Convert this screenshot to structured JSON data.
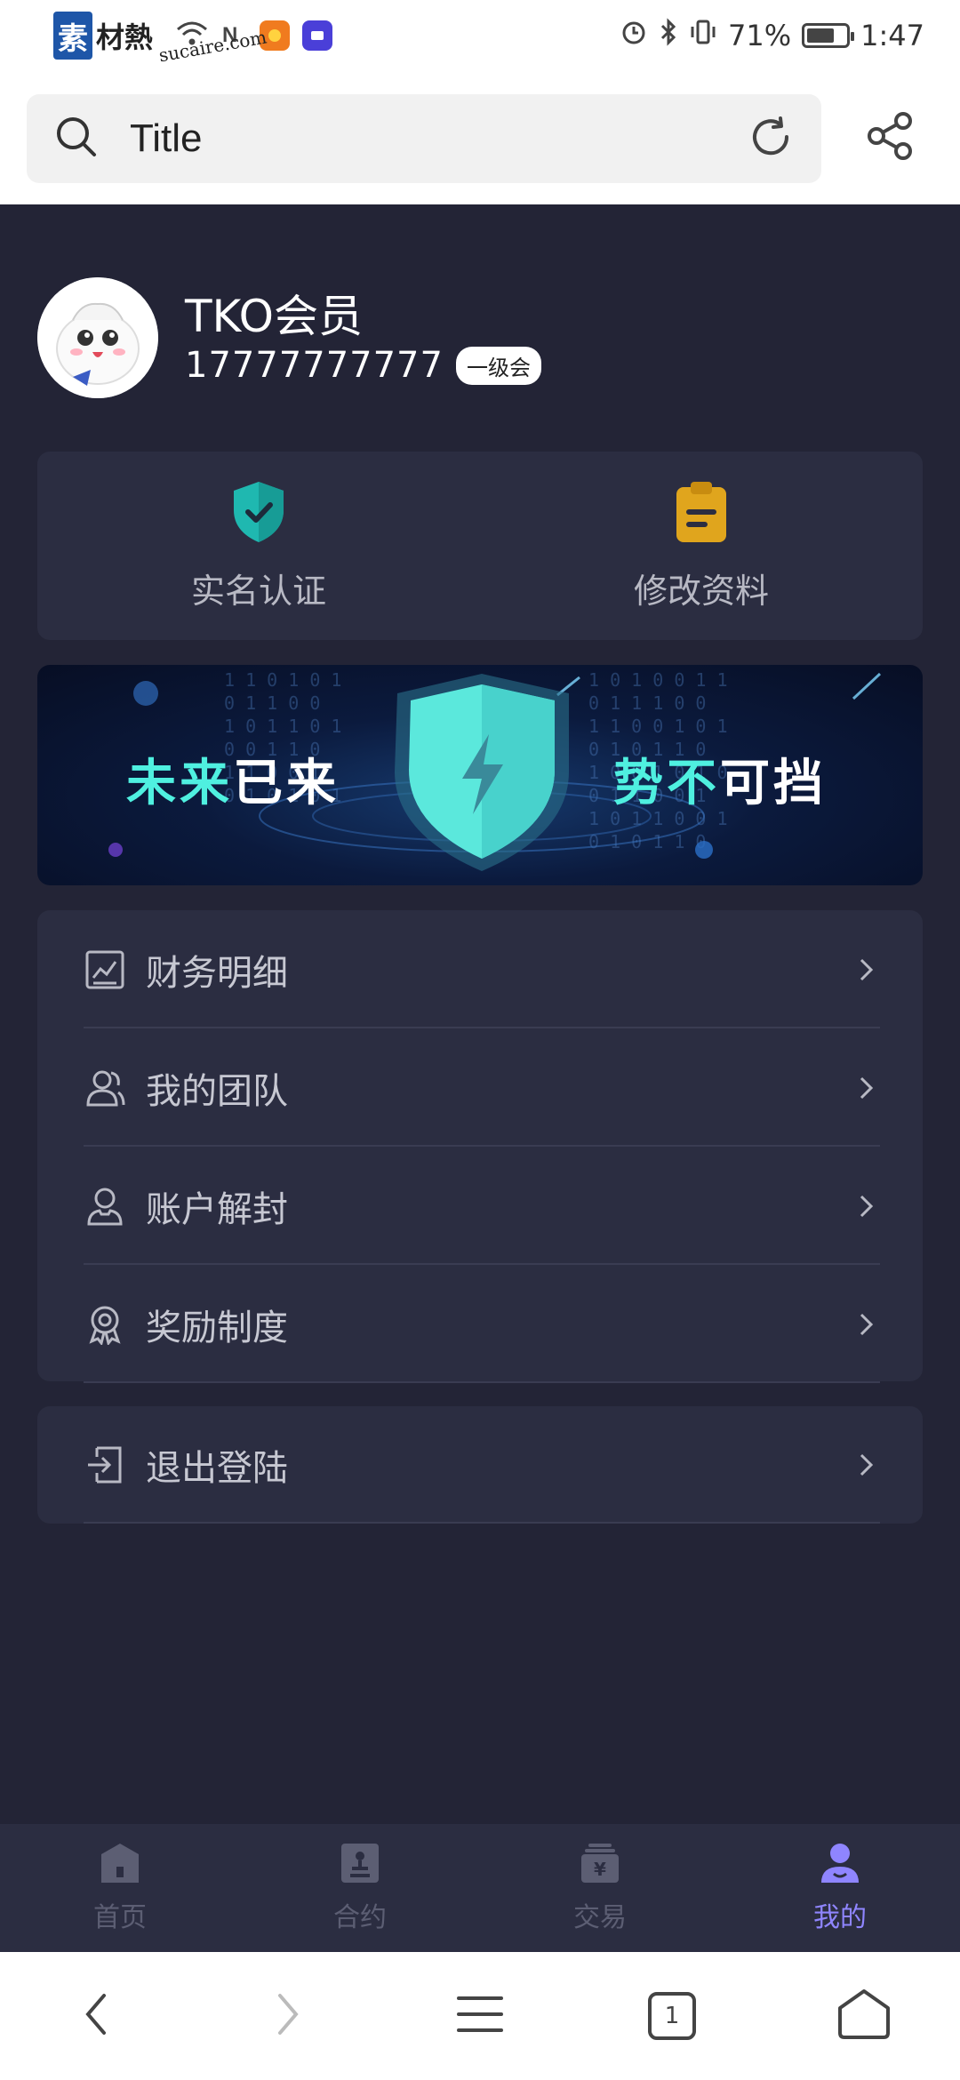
{
  "status_bar": {
    "watermark_main": "素",
    "watermark_text": "材熱",
    "watermark_sub": "sucaire.com",
    "battery_percent": "71%",
    "battery_level": 0.71,
    "time": "1:47"
  },
  "search": {
    "title": "Title",
    "search_icon": "search-icon",
    "refresh_icon": "refresh-icon",
    "share_icon": "share-icon"
  },
  "profile": {
    "name": "TKO会员",
    "phone": "17777777777",
    "level": "一级会"
  },
  "actions": [
    {
      "label": "实名认证",
      "icon": "shield-check-icon",
      "color": "#1fb8b0"
    },
    {
      "label": "修改资料",
      "icon": "clipboard-icon",
      "color": "#e0a51d"
    }
  ],
  "banner": {
    "left_part1": "未来",
    "left_part2": "已来",
    "right_part1": "势不",
    "right_part2": "可挡"
  },
  "menu": {
    "items": [
      {
        "label": "财务明细",
        "icon": "chart-icon"
      },
      {
        "label": "我的团队",
        "icon": "team-icon"
      },
      {
        "label": "账户解封",
        "icon": "user-icon"
      },
      {
        "label": "奖励制度",
        "icon": "award-icon"
      }
    ],
    "logout": {
      "label": "退出登陆",
      "icon": "logout-icon"
    }
  },
  "tabs": [
    {
      "label": "首页",
      "icon": "home-icon",
      "active": false
    },
    {
      "label": "合约",
      "icon": "contract-icon",
      "active": false
    },
    {
      "label": "交易",
      "icon": "trade-icon",
      "active": false
    },
    {
      "label": "我的",
      "icon": "profile-icon",
      "active": true
    }
  ],
  "system_nav": {
    "tab_count": "1"
  },
  "colors": {
    "background": "#232436",
    "card": "#2b2d41",
    "accent": "#8f85ff",
    "teal": "#1fb8b0",
    "gold": "#e0a51d"
  }
}
